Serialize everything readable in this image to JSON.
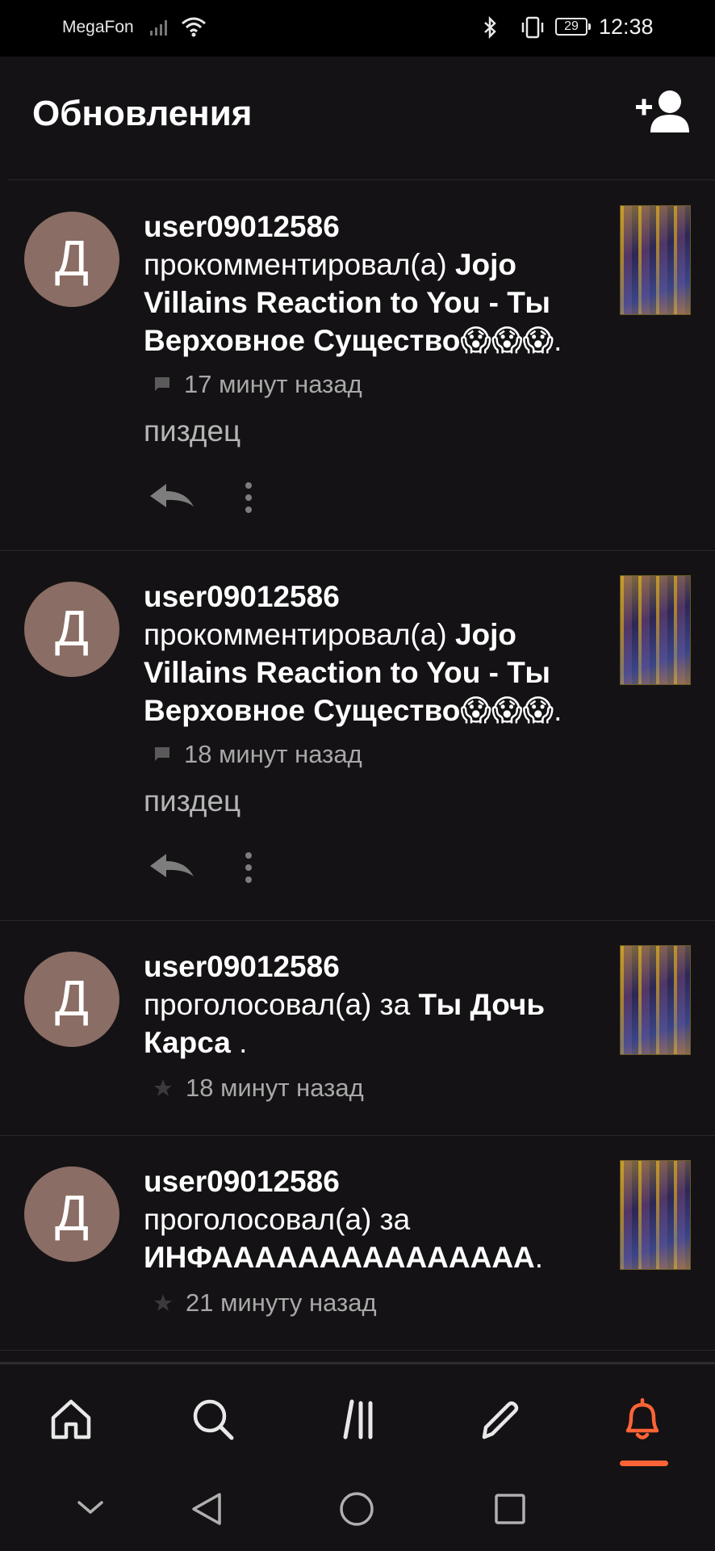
{
  "status_bar": {
    "carrier": "MegaFon",
    "battery": "29",
    "time": "12:38"
  },
  "header": {
    "title": "Обновления",
    "add_user_icon": "add-user-icon"
  },
  "feed": [
    {
      "avatar_letter": "Д",
      "username": "user09012586",
      "action": "прокомментировал(а) ",
      "target": "Jojo Villains Reaction to You - Ты Верховное Существо😱😱😱",
      "suffix": ".",
      "meta_icon": "comment-icon",
      "time": "17 минут назад",
      "comment": "пиздец"
    },
    {
      "avatar_letter": "Д",
      "username": "user09012586",
      "action": "прокомментировал(а) ",
      "target": "Jojo Villains Reaction to You - Ты Верховное Существо😱😱😱",
      "suffix": ".",
      "meta_icon": "comment-icon",
      "time": "18 минут назад",
      "comment": "пиздец"
    },
    {
      "avatar_letter": "Д",
      "username": "user09012586",
      "action": "проголосовал(а) за ",
      "target": "Ты Дочь Карса",
      "suffix": " .",
      "meta_icon": "star-icon",
      "time": "18 минут назад"
    },
    {
      "avatar_letter": "Д",
      "username": "user09012586",
      "action": "проголосовал(а) за ",
      "target": "ИНФААААААААААААААА",
      "suffix": ".",
      "meta_icon": "star-icon",
      "time": "21 минуту назад"
    }
  ],
  "bottom_nav": [
    {
      "name": "home",
      "icon": "home-icon"
    },
    {
      "name": "search",
      "icon": "search-icon"
    },
    {
      "name": "library",
      "icon": "library-icon"
    },
    {
      "name": "write",
      "icon": "pencil-icon"
    },
    {
      "name": "notifications",
      "icon": "bell-icon",
      "active": true
    }
  ],
  "colors": {
    "background": "#141214",
    "accent": "#ff6336",
    "avatar": "#8a6d64",
    "muted_text": "#a8a8a8"
  }
}
